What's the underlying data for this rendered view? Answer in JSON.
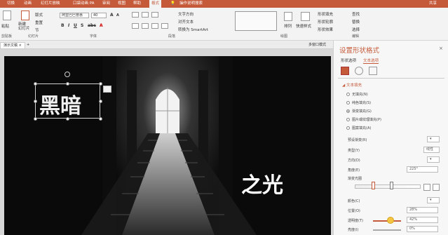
{
  "ribbon_tabs": [
    "切换",
    "动画",
    "幻灯片放映",
    "口袋动画 PA",
    "审阅",
    "视图",
    "帮助",
    "格式",
    "操作说明搜索"
  ],
  "share": "共享",
  "ribbon": {
    "new_slide": "新建\n幻灯片",
    "layout": "版式",
    "reset": "重置",
    "section": "节",
    "group_slides": "幻灯片",
    "font_name": "阿里巴巴普惠",
    "font_size": "40",
    "group_font": "字体",
    "text_direction": "文字方向",
    "align_text": "对齐文本",
    "convert_smartart": "转换为 SmartArt",
    "group_paragraph": "段落",
    "arrange": "排列",
    "quick_styles": "快速样式",
    "shape_fill": "形状填充",
    "shape_outline": "形状轮廓",
    "shape_effects": "形状效果",
    "group_drawing": "绘图",
    "find": "查找",
    "replace": "替换",
    "select": "选择",
    "group_editing": "编辑",
    "left_labels": [
      "粘贴",
      "剪贴板"
    ]
  },
  "doc_tab": "演示文稿",
  "strip_right": "多窗口模式",
  "slide": {
    "text1": "黑暗",
    "text2": "之光"
  },
  "pane": {
    "title": "设置形状格式",
    "sub_tabs": [
      "形状选项",
      "文本选项"
    ],
    "section": "文本填充",
    "fill_options": [
      {
        "label": "无填充(N)",
        "checked": false
      },
      {
        "label": "纯色填充(S)",
        "checked": false
      },
      {
        "label": "渐变填充(G)",
        "checked": true
      },
      {
        "label": "图片或纹理填充(P)",
        "checked": false
      },
      {
        "label": "图案填充(A)",
        "checked": false
      }
    ],
    "preset_gradient": "预设渐变(R)",
    "type": "类型(Y)",
    "type_value": "线性",
    "direction": "方向(D)",
    "angle": "角度(E)",
    "angle_value": "225°",
    "gradient_stops": "渐变光圈",
    "color": "颜色(C)",
    "position": "位置(O)",
    "position_value": "28%",
    "transparency": "透明度(T)",
    "transparency_value": "42%",
    "brightness": "亮度(I)",
    "brightness_value": "0%",
    "accent_color": "#c55a3a"
  }
}
